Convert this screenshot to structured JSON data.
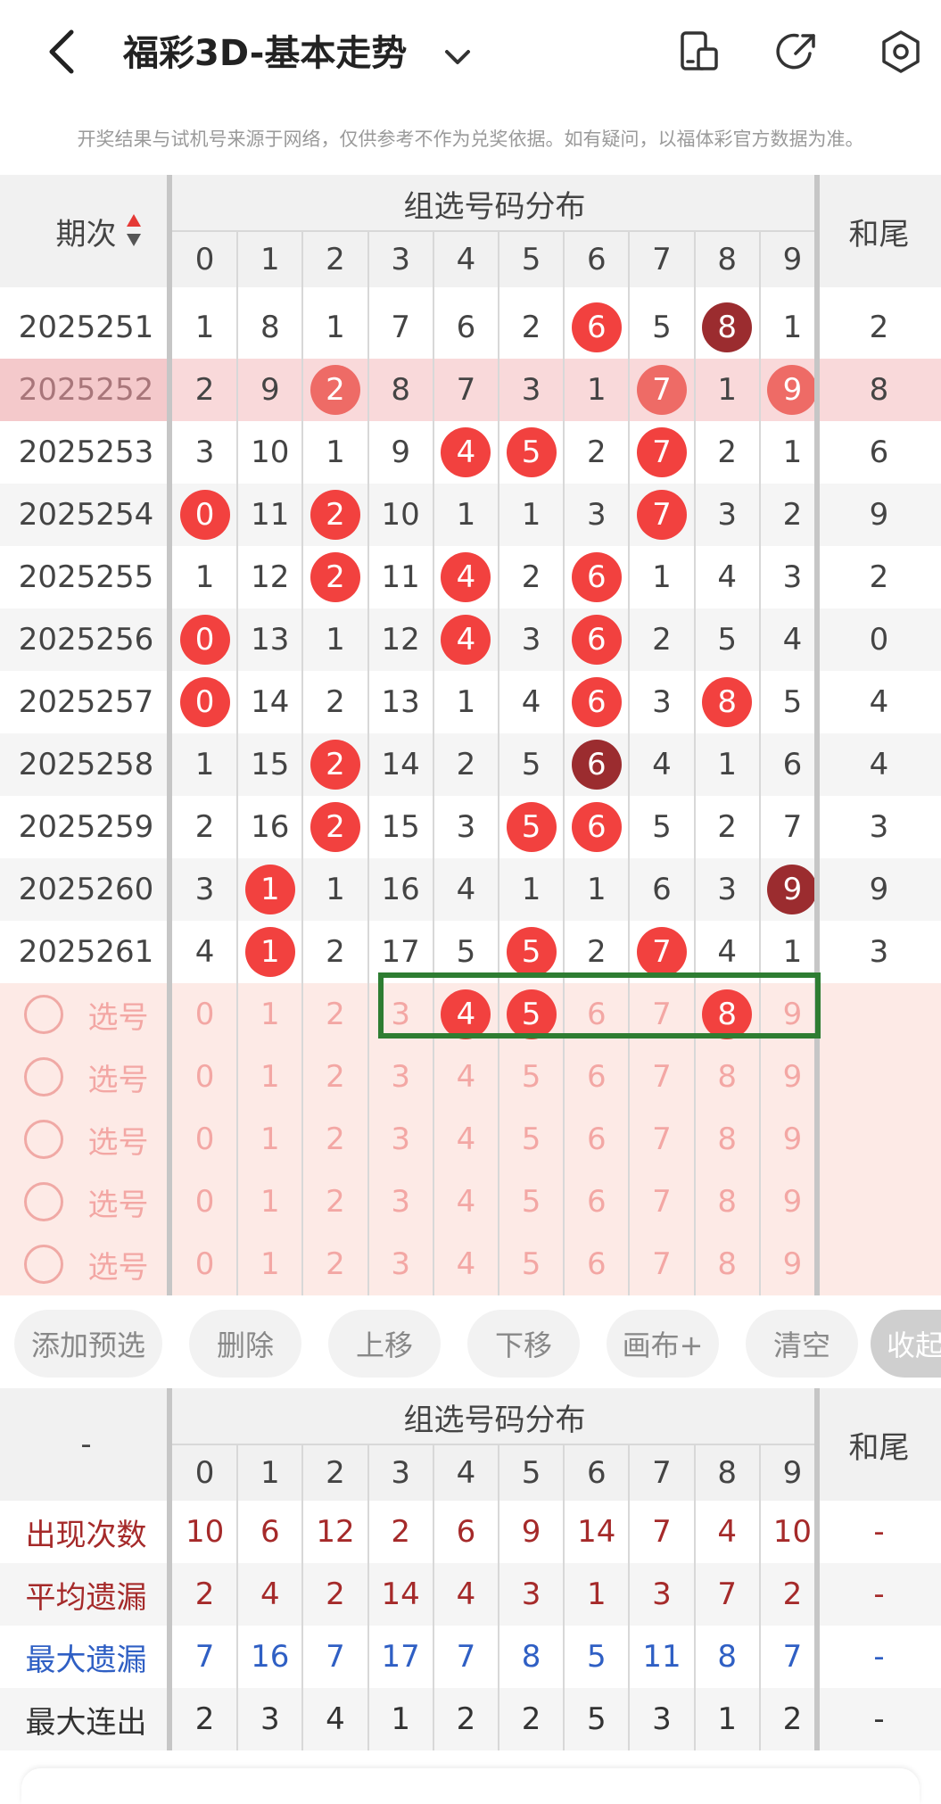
{
  "header": {
    "title": "福彩3D-基本走势",
    "notice": "开奖结果与试机号来源于网络，仅供参考不作为兑奖依据。如有疑问，以福体彩官方数据为准。"
  },
  "table": {
    "col_period": "期次",
    "group_title": "组选号码分布",
    "col_sum_tail": "和尾",
    "digits": [
      "0",
      "1",
      "2",
      "3",
      "4",
      "5",
      "6",
      "7",
      "8",
      "9"
    ],
    "rows": [
      {
        "period": "2025251",
        "cells": [
          "1",
          "8",
          "1",
          "7",
          "6",
          "2",
          "6",
          "5",
          "8",
          "1"
        ],
        "hits": [
          6,
          8
        ],
        "dark": [
          8
        ],
        "tail": "2"
      },
      {
        "period": "2025252",
        "cells": [
          "2",
          "9",
          "2",
          "8",
          "7",
          "3",
          "1",
          "7",
          "1",
          "9"
        ],
        "hits": [
          2,
          7,
          9
        ],
        "dark": [],
        "tail": "8",
        "highlight": true
      },
      {
        "period": "2025253",
        "cells": [
          "3",
          "10",
          "1",
          "9",
          "4",
          "5",
          "2",
          "7",
          "2",
          "1"
        ],
        "hits": [
          4,
          5,
          7
        ],
        "dark": [],
        "tail": "6"
      },
      {
        "period": "2025254",
        "cells": [
          "0",
          "11",
          "2",
          "10",
          "1",
          "1",
          "3",
          "7",
          "3",
          "2"
        ],
        "hits": [
          0,
          2,
          7
        ],
        "dark": [],
        "tail": "9"
      },
      {
        "period": "2025255",
        "cells": [
          "1",
          "12",
          "2",
          "11",
          "4",
          "2",
          "6",
          "1",
          "4",
          "3"
        ],
        "hits": [
          2,
          4,
          6
        ],
        "dark": [],
        "tail": "2"
      },
      {
        "period": "2025256",
        "cells": [
          "0",
          "13",
          "1",
          "12",
          "4",
          "3",
          "6",
          "2",
          "5",
          "4"
        ],
        "hits": [
          0,
          4,
          6
        ],
        "dark": [],
        "tail": "0"
      },
      {
        "period": "2025257",
        "cells": [
          "0",
          "14",
          "2",
          "13",
          "1",
          "4",
          "6",
          "3",
          "8",
          "5"
        ],
        "hits": [
          0,
          6,
          8
        ],
        "dark": [],
        "tail": "4"
      },
      {
        "period": "2025258",
        "cells": [
          "1",
          "15",
          "2",
          "14",
          "2",
          "5",
          "6",
          "4",
          "1",
          "6"
        ],
        "hits": [
          2,
          6
        ],
        "dark": [
          6
        ],
        "tail": "4"
      },
      {
        "period": "2025259",
        "cells": [
          "2",
          "16",
          "2",
          "15",
          "3",
          "5",
          "6",
          "5",
          "2",
          "7"
        ],
        "hits": [
          2,
          5,
          6
        ],
        "dark": [],
        "tail": "3"
      },
      {
        "period": "2025260",
        "cells": [
          "3",
          "1",
          "1",
          "16",
          "4",
          "1",
          "1",
          "6",
          "3",
          "9"
        ],
        "hits": [
          1,
          9
        ],
        "dark": [
          9
        ],
        "tail": "9"
      },
      {
        "period": "2025261",
        "cells": [
          "4",
          "1",
          "2",
          "17",
          "5",
          "5",
          "2",
          "7",
          "4",
          "1"
        ],
        "hits": [
          1,
          5,
          7
        ],
        "dark": [],
        "tail": "3"
      }
    ],
    "pick_label": "选号",
    "pick_rows": [
      {
        "selected": [
          4,
          5,
          8
        ]
      },
      {
        "selected": []
      },
      {
        "selected": []
      },
      {
        "selected": []
      },
      {
        "selected": []
      }
    ]
  },
  "buttons": {
    "add": "添加预选",
    "delete": "删除",
    "up": "上移",
    "down": "下移",
    "canvas": "画布+",
    "clear": "清空",
    "collapse": "收起"
  },
  "stats": {
    "corner": "-",
    "group_title": "组选号码分布",
    "col_sum_tail": "和尾",
    "rows": [
      {
        "label": "出现次数",
        "color": "#a52a2a",
        "values": [
          "10",
          "6",
          "12",
          "2",
          "6",
          "9",
          "14",
          "7",
          "4",
          "10"
        ],
        "tail": "-"
      },
      {
        "label": "平均遗漏",
        "color": "#a52a2a",
        "values": [
          "2",
          "4",
          "2",
          "14",
          "4",
          "3",
          "1",
          "3",
          "7",
          "2"
        ],
        "tail": "-"
      },
      {
        "label": "最大遗漏",
        "color": "#2f5fc4",
        "values": [
          "7",
          "16",
          "7",
          "17",
          "7",
          "8",
          "5",
          "11",
          "8",
          "7"
        ],
        "tail": "-"
      },
      {
        "label": "最大连出",
        "color": "#333333",
        "values": [
          "2",
          "3",
          "4",
          "1",
          "2",
          "2",
          "5",
          "3",
          "1",
          "2"
        ],
        "tail": "-"
      }
    ]
  },
  "colors": {
    "hit": "#f2413f",
    "hit_dark": "#9b2c2f",
    "pick_bg": "#fdeae6",
    "highlight_row": "#f9d9da",
    "selection_box": "#2e7d32"
  }
}
